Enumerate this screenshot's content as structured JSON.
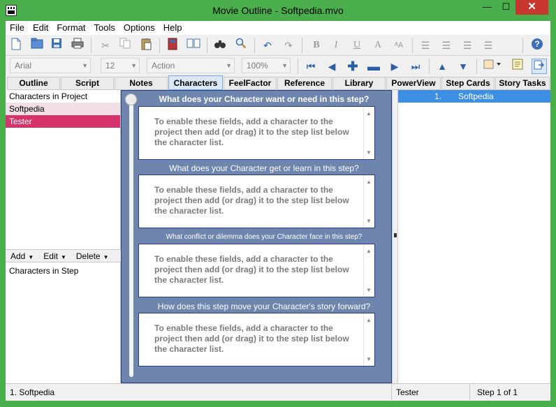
{
  "window": {
    "title": "Movie Outline - Softpedia.mvo",
    "minimize_glyph": "—",
    "maximize_glyph": "☐",
    "close_glyph": "✕"
  },
  "menu": [
    "File",
    "Edit",
    "Format",
    "Tools",
    "Options",
    "Help"
  ],
  "toolbar1": {
    "icons": [
      "new-document-icon",
      "open-folder-icon",
      "save-icon",
      "print-icon",
      "cut-icon",
      "copy-icon",
      "paste-icon",
      "book-icon",
      "open-book-icon",
      "binoculars-icon",
      "magnifier-icon",
      "undo-icon",
      "redo-icon",
      "bold-icon",
      "italic-icon",
      "underline-icon",
      "font-color-icon",
      "clear-format-icon",
      "align-left-icon",
      "align-center-icon",
      "align-right-icon",
      "justify-icon",
      "help-icon"
    ]
  },
  "toolbar2": {
    "font_family": "Arial",
    "font_size": "12",
    "element_type": "Action",
    "zoom": "100%",
    "icons": [
      "first-step-icon",
      "previous-step-icon",
      "add-step-icon",
      "remove-step-icon",
      "next-step-icon",
      "last-step-icon",
      "move-up-icon",
      "move-down-icon",
      "color-swatch-icon",
      "note-icon",
      "export-icon"
    ]
  },
  "tabs": [
    "Outline",
    "Script",
    "Notes",
    "Characters",
    "FeelFactor",
    "Reference",
    "Library",
    "PowerView",
    "Step Cards",
    "Story Tasks"
  ],
  "active_tab": "Characters",
  "left_panel": {
    "project_header": "Characters in Project",
    "characters": [
      "Softpedia",
      "Tester"
    ],
    "selected_character": "Tester",
    "actions": [
      "Add",
      "Edit",
      "Delete"
    ],
    "step_header": "Characters in Step"
  },
  "center_panel": {
    "questions": [
      "What does your Character want or need in this step?",
      "What does your Character get or learn in this step?",
      "What conflict or dilemma does your Character face in this step?",
      "How does this step move your Character's story forward?"
    ],
    "placeholder_text": "To enable these fields, add a character to the project then add (or drag) it to the step list below the character list."
  },
  "right_panel": {
    "steps": [
      {
        "number": "1.",
        "name": "Softpedia"
      }
    ]
  },
  "status_bar": {
    "current_step": "1.  Softpedia",
    "current_character": "Tester",
    "step_position": "Step 1 of 1"
  },
  "colors": {
    "window_frame": "#4aae4c",
    "close_button": "#c7372f",
    "selected_character": "#d6336b",
    "center_background": "#6e86ad",
    "selected_step": "#3d8fe3"
  }
}
